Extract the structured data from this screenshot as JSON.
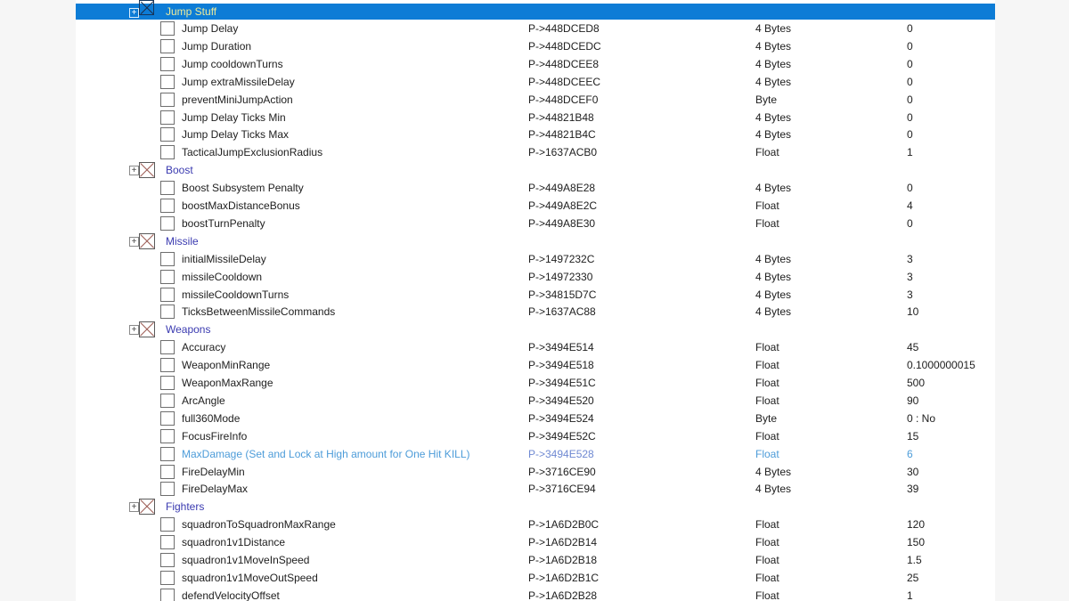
{
  "app": {
    "panel": "cheat-table-record-list",
    "colors": {
      "margin_bg": "#f6f6f6",
      "content_bg": "#ffffff",
      "selection_bg": "#0d7cd6",
      "selected_group_text": "#eeeb9a",
      "group_text": "#3a3ab0",
      "entry_text": "#202020",
      "highlight_text": "#4d9cd9",
      "highlight_address_text": "#6f89d2",
      "group_x_mark": "#9b5a52"
    }
  },
  "table": {
    "rows": [
      {
        "kind": "group",
        "label": "Jump Stuff",
        "selected": true,
        "checked": true,
        "expander": "+"
      },
      {
        "kind": "entry",
        "label": "Jump Delay",
        "address": "P->448DCED8",
        "type": "4 Bytes",
        "value": "0"
      },
      {
        "kind": "entry",
        "label": "Jump Duration",
        "address": "P->448DCEDC",
        "type": "4 Bytes",
        "value": "0"
      },
      {
        "kind": "entry",
        "label": "Jump cooldownTurns",
        "address": "P->448DCEE8",
        "type": "4 Bytes",
        "value": "0"
      },
      {
        "kind": "entry",
        "label": "Jump extraMissileDelay",
        "address": "P->448DCEEC",
        "type": "4 Bytes",
        "value": "0"
      },
      {
        "kind": "entry",
        "label": "preventMiniJumpAction",
        "address": "P->448DCEF0",
        "type": "Byte",
        "value": "0"
      },
      {
        "kind": "entry",
        "label": "Jump Delay Ticks Min",
        "address": "P->44821B48",
        "type": "4 Bytes",
        "value": "0"
      },
      {
        "kind": "entry",
        "label": "Jump Delay Ticks Max",
        "address": "P->44821B4C",
        "type": "4 Bytes",
        "value": "0"
      },
      {
        "kind": "entry",
        "label": "TacticalJumpExclusionRadius",
        "address": "P->1637ACB0",
        "type": "Float",
        "value": "1"
      },
      {
        "kind": "group",
        "label": "Boost",
        "selected": false,
        "checked": true,
        "expander": "+"
      },
      {
        "kind": "entry",
        "label": "Boost Subsystem Penalty",
        "address": "P->449A8E28",
        "type": "4 Bytes",
        "value": "0"
      },
      {
        "kind": "entry",
        "label": "boostMaxDistanceBonus",
        "address": "P->449A8E2C",
        "type": "Float",
        "value": "4"
      },
      {
        "kind": "entry",
        "label": "boostTurnPenalty",
        "address": "P->449A8E30",
        "type": "Float",
        "value": "0"
      },
      {
        "kind": "group",
        "label": "Missile",
        "selected": false,
        "checked": true,
        "expander": "+"
      },
      {
        "kind": "entry",
        "label": "initialMissileDelay",
        "address": "P->1497232C",
        "type": "4 Bytes",
        "value": "3"
      },
      {
        "kind": "entry",
        "label": "missileCooldown",
        "address": "P->14972330",
        "type": "4 Bytes",
        "value": "3"
      },
      {
        "kind": "entry",
        "label": "missileCooldownTurns",
        "address": "P->34815D7C",
        "type": "4 Bytes",
        "value": "3"
      },
      {
        "kind": "entry",
        "label": "TicksBetweenMissileCommands",
        "address": "P->1637AC88",
        "type": "4 Bytes",
        "value": "10"
      },
      {
        "kind": "group",
        "label": "Weapons",
        "selected": false,
        "checked": true,
        "expander": "+"
      },
      {
        "kind": "entry",
        "label": "Accuracy",
        "address": "P->3494E514",
        "type": "Float",
        "value": "45"
      },
      {
        "kind": "entry",
        "label": "WeaponMinRange",
        "address": "P->3494E518",
        "type": "Float",
        "value": "0.1000000015"
      },
      {
        "kind": "entry",
        "label": "WeaponMaxRange",
        "address": "P->3494E51C",
        "type": "Float",
        "value": "500"
      },
      {
        "kind": "entry",
        "label": "ArcAngle",
        "address": "P->3494E520",
        "type": "Float",
        "value": "90"
      },
      {
        "kind": "entry",
        "label": "full360Mode",
        "address": "P->3494E524",
        "type": "Byte",
        "value": "0 : No"
      },
      {
        "kind": "entry",
        "label": "FocusFireInfo",
        "address": "P->3494E52C",
        "type": "Float",
        "value": "15"
      },
      {
        "kind": "entry",
        "label": "MaxDamage (Set and Lock at High amount for One Hit KILL)",
        "address": "P->3494E528",
        "type": "Float",
        "value": "6",
        "highlight": true
      },
      {
        "kind": "entry",
        "label": "FireDelayMin",
        "address": "P->3716CE90",
        "type": "4 Bytes",
        "value": "30"
      },
      {
        "kind": "entry",
        "label": "FireDelayMax",
        "address": "P->3716CE94",
        "type": "4 Bytes",
        "value": "39"
      },
      {
        "kind": "group",
        "label": "Fighters",
        "selected": false,
        "checked": true,
        "expander": "+"
      },
      {
        "kind": "entry",
        "label": "squadronToSquadronMaxRange",
        "address": "P->1A6D2B0C",
        "type": "Float",
        "value": "120"
      },
      {
        "kind": "entry",
        "label": "squadron1v1Distance",
        "address": "P->1A6D2B14",
        "type": "Float",
        "value": "150"
      },
      {
        "kind": "entry",
        "label": "squadron1v1MoveInSpeed",
        "address": "P->1A6D2B18",
        "type": "Float",
        "value": "1.5"
      },
      {
        "kind": "entry",
        "label": "squadron1v1MoveOutSpeed",
        "address": "P->1A6D2B1C",
        "type": "Float",
        "value": "25"
      },
      {
        "kind": "entry",
        "label": "defendVelocityOffset",
        "address": "P->1A6D2B28",
        "type": "Float",
        "value": "1"
      }
    ]
  }
}
